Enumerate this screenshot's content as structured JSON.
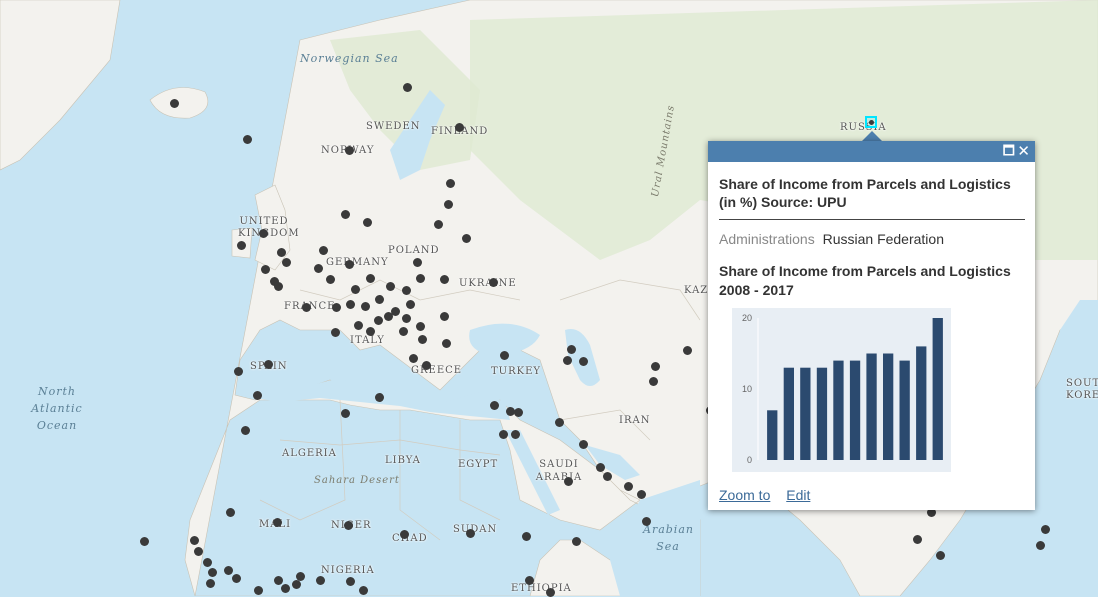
{
  "map_labels": {
    "countries": {
      "russia": "RUSSIA",
      "sweden": "SWEDEN",
      "finland": "FINLAND",
      "norway": "NORWAY",
      "united_kingdom": "UNITED KINGDOM",
      "germany": "GERMANY",
      "poland": "POLAND",
      "ukraine": "UKRAINE",
      "france": "FRANCE",
      "italy": "ITALY",
      "spain": "SPAIN",
      "greece": "GREECE",
      "turkey": "TURKEY",
      "iran": "IRAN",
      "kazakhstan": "KAZA",
      "south_korea": "SOUTH KOREA",
      "algeria": "ALGERIA",
      "libya": "LIBYA",
      "egypt": "EGYPT",
      "saudi_arabia": "SAUDI ARABIA",
      "mali": "MALI",
      "niger": "NIGER",
      "chad": "CHAD",
      "sudan": "SUDAN",
      "nigeria": "NIGERIA",
      "ethiopia": "ETHIOPIA"
    },
    "water": {
      "norwegian_sea": "Norwegian Sea",
      "north_atlantic": "North Atlantic Ocean",
      "arabian_sea": "Arabian Sea"
    },
    "terrain": {
      "ural": "Ural Mountains",
      "sahara": "Sahara Desert"
    }
  },
  "popup": {
    "title": "Share of Income from Parcels and Logistics (in %) Source: UPU",
    "attribute_key": "Administrations",
    "attribute_value": "Russian Federation",
    "chart_title": "Share of Income from Parcels and Logistics 2008 - 2017",
    "zoom_label": "Zoom to",
    "edit_label": "Edit",
    "maximize_icon": "maximize-icon",
    "close_icon": "close-icon"
  },
  "chart_data": {
    "type": "bar",
    "title": "",
    "categories": [],
    "values": [
      7,
      13,
      13,
      13,
      14,
      14,
      15,
      15,
      14,
      16,
      20
    ],
    "ylim": [
      0,
      20
    ],
    "y_ticks": [
      0,
      10,
      20
    ],
    "bar_color": "#2b4a6f",
    "grid": false
  },
  "colors": {
    "ocean": "#c7e4f3",
    "land": "#f3f2ee",
    "forest": "#dfead2",
    "popup_header": "#4c7fae",
    "selection": "#00e5ff"
  }
}
